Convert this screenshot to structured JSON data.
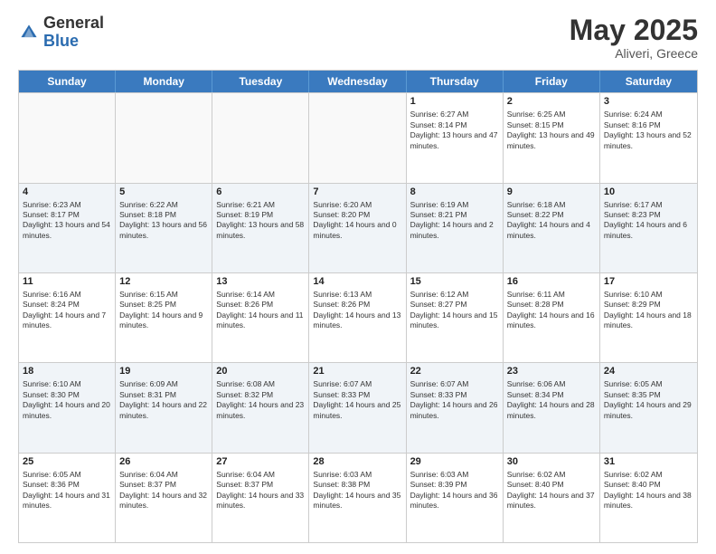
{
  "header": {
    "logo_general": "General",
    "logo_blue": "Blue",
    "month_title": "May 2025",
    "location": "Aliveri, Greece"
  },
  "weekdays": [
    "Sunday",
    "Monday",
    "Tuesday",
    "Wednesday",
    "Thursday",
    "Friday",
    "Saturday"
  ],
  "rows": [
    [
      {
        "day": "",
        "sunrise": "",
        "sunset": "",
        "daylight": "",
        "alt": false
      },
      {
        "day": "",
        "sunrise": "",
        "sunset": "",
        "daylight": "",
        "alt": false
      },
      {
        "day": "",
        "sunrise": "",
        "sunset": "",
        "daylight": "",
        "alt": false
      },
      {
        "day": "",
        "sunrise": "",
        "sunset": "",
        "daylight": "",
        "alt": false
      },
      {
        "day": "1",
        "sunrise": "Sunrise: 6:27 AM",
        "sunset": "Sunset: 8:14 PM",
        "daylight": "Daylight: 13 hours and 47 minutes.",
        "alt": false
      },
      {
        "day": "2",
        "sunrise": "Sunrise: 6:25 AM",
        "sunset": "Sunset: 8:15 PM",
        "daylight": "Daylight: 13 hours and 49 minutes.",
        "alt": false
      },
      {
        "day": "3",
        "sunrise": "Sunrise: 6:24 AM",
        "sunset": "Sunset: 8:16 PM",
        "daylight": "Daylight: 13 hours and 52 minutes.",
        "alt": false
      }
    ],
    [
      {
        "day": "4",
        "sunrise": "Sunrise: 6:23 AM",
        "sunset": "Sunset: 8:17 PM",
        "daylight": "Daylight: 13 hours and 54 minutes.",
        "alt": true
      },
      {
        "day": "5",
        "sunrise": "Sunrise: 6:22 AM",
        "sunset": "Sunset: 8:18 PM",
        "daylight": "Daylight: 13 hours and 56 minutes.",
        "alt": true
      },
      {
        "day": "6",
        "sunrise": "Sunrise: 6:21 AM",
        "sunset": "Sunset: 8:19 PM",
        "daylight": "Daylight: 13 hours and 58 minutes.",
        "alt": true
      },
      {
        "day": "7",
        "sunrise": "Sunrise: 6:20 AM",
        "sunset": "Sunset: 8:20 PM",
        "daylight": "Daylight: 14 hours and 0 minutes.",
        "alt": true
      },
      {
        "day": "8",
        "sunrise": "Sunrise: 6:19 AM",
        "sunset": "Sunset: 8:21 PM",
        "daylight": "Daylight: 14 hours and 2 minutes.",
        "alt": true
      },
      {
        "day": "9",
        "sunrise": "Sunrise: 6:18 AM",
        "sunset": "Sunset: 8:22 PM",
        "daylight": "Daylight: 14 hours and 4 minutes.",
        "alt": true
      },
      {
        "day": "10",
        "sunrise": "Sunrise: 6:17 AM",
        "sunset": "Sunset: 8:23 PM",
        "daylight": "Daylight: 14 hours and 6 minutes.",
        "alt": true
      }
    ],
    [
      {
        "day": "11",
        "sunrise": "Sunrise: 6:16 AM",
        "sunset": "Sunset: 8:24 PM",
        "daylight": "Daylight: 14 hours and 7 minutes.",
        "alt": false
      },
      {
        "day": "12",
        "sunrise": "Sunrise: 6:15 AM",
        "sunset": "Sunset: 8:25 PM",
        "daylight": "Daylight: 14 hours and 9 minutes.",
        "alt": false
      },
      {
        "day": "13",
        "sunrise": "Sunrise: 6:14 AM",
        "sunset": "Sunset: 8:26 PM",
        "daylight": "Daylight: 14 hours and 11 minutes.",
        "alt": false
      },
      {
        "day": "14",
        "sunrise": "Sunrise: 6:13 AM",
        "sunset": "Sunset: 8:26 PM",
        "daylight": "Daylight: 14 hours and 13 minutes.",
        "alt": false
      },
      {
        "day": "15",
        "sunrise": "Sunrise: 6:12 AM",
        "sunset": "Sunset: 8:27 PM",
        "daylight": "Daylight: 14 hours and 15 minutes.",
        "alt": false
      },
      {
        "day": "16",
        "sunrise": "Sunrise: 6:11 AM",
        "sunset": "Sunset: 8:28 PM",
        "daylight": "Daylight: 14 hours and 16 minutes.",
        "alt": false
      },
      {
        "day": "17",
        "sunrise": "Sunrise: 6:10 AM",
        "sunset": "Sunset: 8:29 PM",
        "daylight": "Daylight: 14 hours and 18 minutes.",
        "alt": false
      }
    ],
    [
      {
        "day": "18",
        "sunrise": "Sunrise: 6:10 AM",
        "sunset": "Sunset: 8:30 PM",
        "daylight": "Daylight: 14 hours and 20 minutes.",
        "alt": true
      },
      {
        "day": "19",
        "sunrise": "Sunrise: 6:09 AM",
        "sunset": "Sunset: 8:31 PM",
        "daylight": "Daylight: 14 hours and 22 minutes.",
        "alt": true
      },
      {
        "day": "20",
        "sunrise": "Sunrise: 6:08 AM",
        "sunset": "Sunset: 8:32 PM",
        "daylight": "Daylight: 14 hours and 23 minutes.",
        "alt": true
      },
      {
        "day": "21",
        "sunrise": "Sunrise: 6:07 AM",
        "sunset": "Sunset: 8:33 PM",
        "daylight": "Daylight: 14 hours and 25 minutes.",
        "alt": true
      },
      {
        "day": "22",
        "sunrise": "Sunrise: 6:07 AM",
        "sunset": "Sunset: 8:33 PM",
        "daylight": "Daylight: 14 hours and 26 minutes.",
        "alt": true
      },
      {
        "day": "23",
        "sunrise": "Sunrise: 6:06 AM",
        "sunset": "Sunset: 8:34 PM",
        "daylight": "Daylight: 14 hours and 28 minutes.",
        "alt": true
      },
      {
        "day": "24",
        "sunrise": "Sunrise: 6:05 AM",
        "sunset": "Sunset: 8:35 PM",
        "daylight": "Daylight: 14 hours and 29 minutes.",
        "alt": true
      }
    ],
    [
      {
        "day": "25",
        "sunrise": "Sunrise: 6:05 AM",
        "sunset": "Sunset: 8:36 PM",
        "daylight": "Daylight: 14 hours and 31 minutes.",
        "alt": false
      },
      {
        "day": "26",
        "sunrise": "Sunrise: 6:04 AM",
        "sunset": "Sunset: 8:37 PM",
        "daylight": "Daylight: 14 hours and 32 minutes.",
        "alt": false
      },
      {
        "day": "27",
        "sunrise": "Sunrise: 6:04 AM",
        "sunset": "Sunset: 8:37 PM",
        "daylight": "Daylight: 14 hours and 33 minutes.",
        "alt": false
      },
      {
        "day": "28",
        "sunrise": "Sunrise: 6:03 AM",
        "sunset": "Sunset: 8:38 PM",
        "daylight": "Daylight: 14 hours and 35 minutes.",
        "alt": false
      },
      {
        "day": "29",
        "sunrise": "Sunrise: 6:03 AM",
        "sunset": "Sunset: 8:39 PM",
        "daylight": "Daylight: 14 hours and 36 minutes.",
        "alt": false
      },
      {
        "day": "30",
        "sunrise": "Sunrise: 6:02 AM",
        "sunset": "Sunset: 8:40 PM",
        "daylight": "Daylight: 14 hours and 37 minutes.",
        "alt": false
      },
      {
        "day": "31",
        "sunrise": "Sunrise: 6:02 AM",
        "sunset": "Sunset: 8:40 PM",
        "daylight": "Daylight: 14 hours and 38 minutes.",
        "alt": false
      }
    ]
  ]
}
